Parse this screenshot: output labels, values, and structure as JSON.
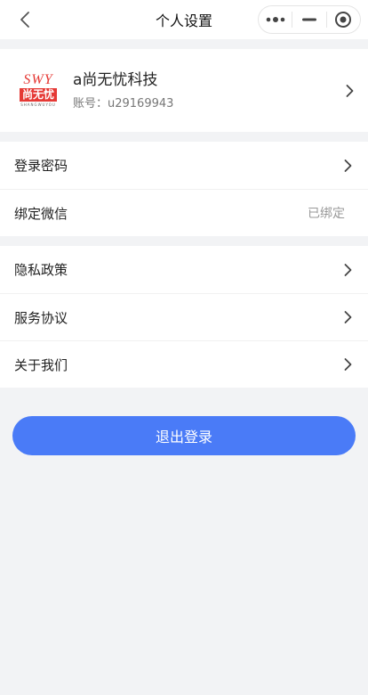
{
  "nav": {
    "title": "个人设置",
    "back_icon": "chevron-left-icon",
    "capsule": [
      "more-dots-icon",
      "minimize-icon",
      "target-circle-icon"
    ]
  },
  "profile": {
    "name": "a尚无忧科技",
    "account": "账号：u29169943",
    "logo": {
      "top_text": "SWY",
      "mid_text": "尚无忧",
      "bottom_text": "SHANGWUYOU"
    }
  },
  "security": {
    "login_password": "登录密码",
    "bind_wechat": "绑定微信",
    "bind_wechat_status": "已绑定"
  },
  "info": {
    "privacy": "隐私政策",
    "service": "服务协议",
    "about": "关于我们"
  },
  "logout_label": "退出登录",
  "colors": {
    "accent": "#4a7bf7",
    "brand_red": "#e53935",
    "background": "#f2f3f5"
  }
}
